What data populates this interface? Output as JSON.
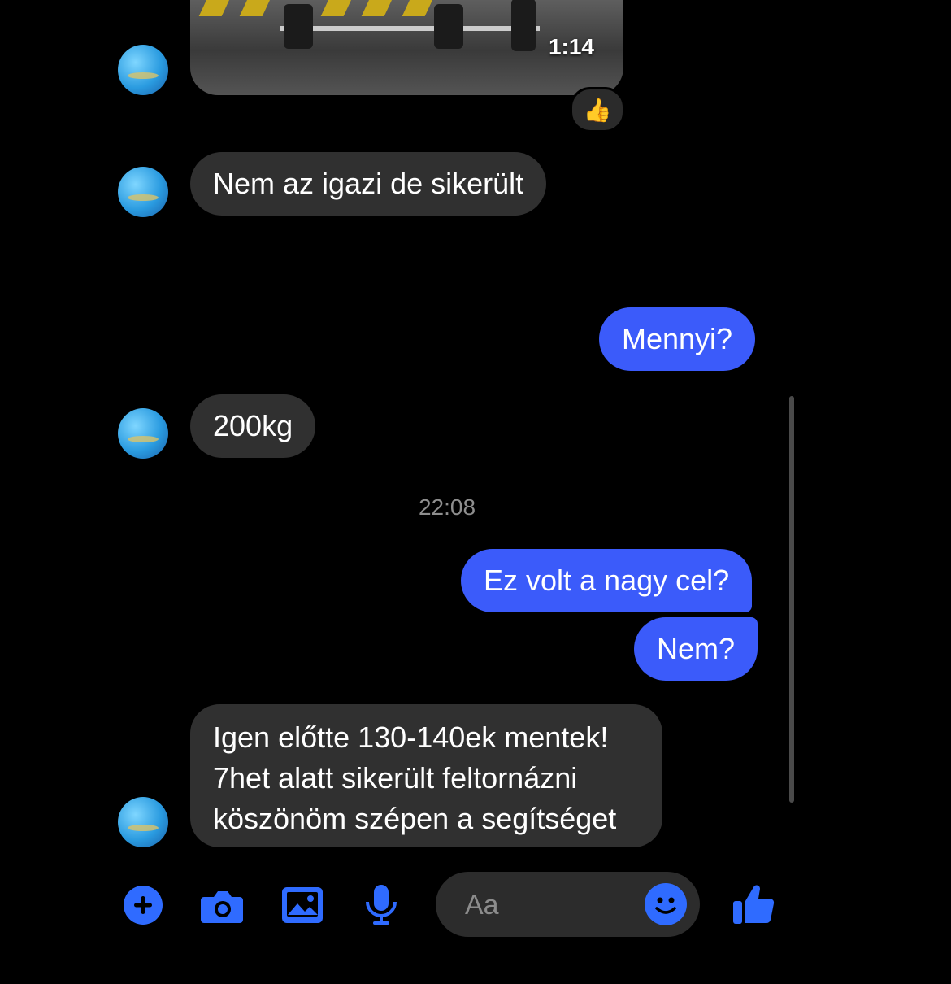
{
  "video": {
    "duration": "1:14",
    "reaction": "👍"
  },
  "messages": {
    "m1": "Nem az igazi de sikerült",
    "m2": "Mennyi?",
    "m3": "200kg",
    "timestamp": "22:08",
    "m4": "Ez volt a nagy cel?",
    "m5": "Nem?",
    "m6_line1": "Igen előtte 130-140ek mentek!",
    "m6_line2": "7het alatt sikerült feltornázni",
    "m6_line3": "köszönöm szépen a segítséget"
  },
  "composer": {
    "placeholder": "Aa"
  },
  "colors": {
    "accent": "#3b5bfa",
    "incoming": "#303030",
    "icon": "#2f6bff"
  },
  "icons": [
    "plus-icon",
    "camera-icon",
    "image-icon",
    "microphone-icon",
    "emoji-icon",
    "thumbs-up-icon"
  ]
}
